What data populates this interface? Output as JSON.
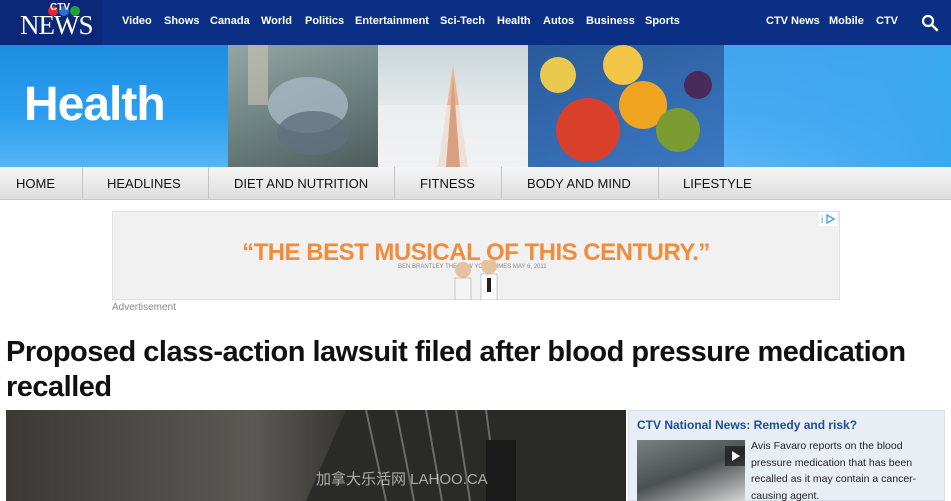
{
  "header": {
    "logo_ctv": "CTV",
    "logo_news": "NEWS",
    "nav": [
      "Video",
      "Shows",
      "Canada",
      "World",
      "Politics",
      "Entertainment",
      "Sci-Tech",
      "Health",
      "Autos",
      "Business",
      "Sports"
    ],
    "right_nav": [
      "CTV News",
      "Mobile",
      "CTV"
    ]
  },
  "banner": {
    "title": "Health"
  },
  "section_nav": [
    "HOME",
    "HEADLINES",
    "DIET AND NUTRITION",
    "FITNESS",
    "BODY AND MIND",
    "LIFESTYLE"
  ],
  "ad": {
    "headline": "“THE BEST MUSICAL OF THIS CENTURY.”",
    "credit": "BEN BRANTLEY  THE NEW YORK TIMES  MAY 6, 2011",
    "label": "Advertisement"
  },
  "article": {
    "headline": "Proposed class-action lawsuit filed after blood pressure medication recalled"
  },
  "video": {
    "watermark": "加拿大乐活网  LAHOO.CA"
  },
  "sidebar": {
    "title": "CTV National News: Remedy and risk?",
    "description": "Avis Favaro reports on the blood pressure medication that has been recalled as it may contain a cancer-causing agent."
  },
  "colors": {
    "topbar": "#0c2f86",
    "banner": "#2e9ff0",
    "ad_text": "#f08c3c",
    "sidebar_title": "#1a4f9a"
  }
}
